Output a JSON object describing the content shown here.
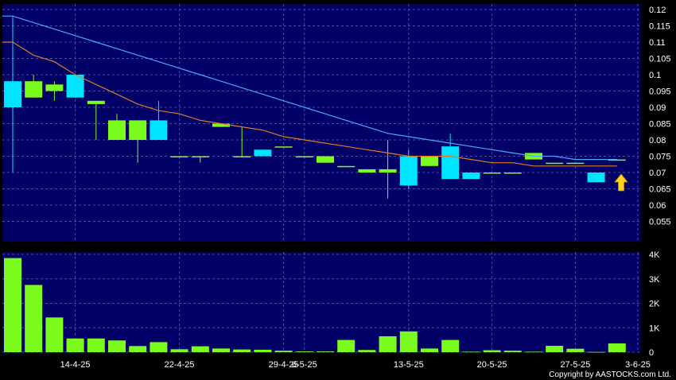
{
  "colors": {
    "panel_bg": "#000066",
    "grid": "#4d4d99",
    "up": "#7cfc1e",
    "down": "#00e5ff",
    "ma_fast": "#e07a2a",
    "ma_slow": "#4aa8ff",
    "volume": "#7cfc1e",
    "arrow": "#ffd21f"
  },
  "chart_data": [
    {
      "type": "candlestick",
      "title": "",
      "ylim": [
        0.05,
        0.12
      ],
      "y_ticks": [
        "0.12",
        "0.115",
        "0.11",
        "0.105",
        "0.1",
        "0.095",
        "0.09",
        "0.085",
        "0.08",
        "0.075",
        "0.07",
        "0.065",
        "0.06",
        "0.055"
      ],
      "x_labels": [
        "14-4-25",
        "22-4-25",
        "29-4-25",
        "6-5-25",
        "13-5-25",
        "20-5-25",
        "27-5-25",
        "3-6-25"
      ],
      "x_label_index": [
        3,
        8,
        13,
        14,
        19,
        23,
        27,
        30
      ],
      "candles": [
        {
          "o": 0.098,
          "h": 0.118,
          "l": 0.07,
          "c": 0.09
        },
        {
          "o": 0.093,
          "h": 0.1,
          "l": 0.093,
          "c": 0.098
        },
        {
          "o": 0.095,
          "h": 0.098,
          "l": 0.092,
          "c": 0.097
        },
        {
          "o": 0.1,
          "h": 0.1,
          "l": 0.093,
          "c": 0.093
        },
        {
          "o": 0.091,
          "h": 0.092,
          "l": 0.08,
          "c": 0.092
        },
        {
          "o": 0.08,
          "h": 0.088,
          "l": 0.08,
          "c": 0.086
        },
        {
          "o": 0.08,
          "h": 0.086,
          "l": 0.073,
          "c": 0.086
        },
        {
          "o": 0.086,
          "h": 0.092,
          "l": 0.08,
          "c": 0.08
        },
        {
          "o": 0.075,
          "h": 0.075,
          "l": 0.075,
          "c": 0.075
        },
        {
          "o": 0.075,
          "h": 0.075,
          "l": 0.073,
          "c": 0.075
        },
        {
          "o": 0.084,
          "h": 0.085,
          "l": 0.084,
          "c": 0.085
        },
        {
          "o": 0.075,
          "h": 0.084,
          "l": 0.075,
          "c": 0.075
        },
        {
          "o": 0.077,
          "h": 0.077,
          "l": 0.075,
          "c": 0.075
        },
        {
          "o": 0.078,
          "h": 0.078,
          "l": 0.078,
          "c": 0.078
        },
        {
          "o": 0.075,
          "h": 0.075,
          "l": 0.075,
          "c": 0.075
        },
        {
          "o": 0.073,
          "h": 0.075,
          "l": 0.073,
          "c": 0.075
        },
        {
          "o": 0.072,
          "h": 0.072,
          "l": 0.072,
          "c": 0.072
        },
        {
          "o": 0.07,
          "h": 0.071,
          "l": 0.07,
          "c": 0.071
        },
        {
          "o": 0.07,
          "h": 0.08,
          "l": 0.062,
          "c": 0.071
        },
        {
          "o": 0.075,
          "h": 0.077,
          "l": 0.065,
          "c": 0.066
        },
        {
          "o": 0.072,
          "h": 0.075,
          "l": 0.072,
          "c": 0.075
        },
        {
          "o": 0.078,
          "h": 0.082,
          "l": 0.068,
          "c": 0.068
        },
        {
          "o": 0.07,
          "h": 0.07,
          "l": 0.068,
          "c": 0.068
        },
        {
          "o": 0.07,
          "h": 0.07,
          "l": 0.07,
          "c": 0.07
        },
        {
          "o": 0.07,
          "h": 0.07,
          "l": 0.07,
          "c": 0.07
        },
        {
          "o": 0.074,
          "h": 0.076,
          "l": 0.074,
          "c": 0.076
        },
        {
          "o": 0.073,
          "h": 0.073,
          "l": 0.073,
          "c": 0.073
        },
        {
          "o": 0.073,
          "h": 0.073,
          "l": 0.073,
          "c": 0.073
        },
        {
          "o": 0.07,
          "h": 0.07,
          "l": 0.067,
          "c": 0.067
        },
        {
          "o": 0.074,
          "h": 0.074,
          "l": 0.074,
          "c": 0.074
        }
      ],
      "ma_fast": [
        0.11,
        0.106,
        0.104,
        0.1,
        0.097,
        0.094,
        0.091,
        0.089,
        0.088,
        0.086,
        0.085,
        0.084,
        0.083,
        0.081,
        0.08,
        0.079,
        0.078,
        0.077,
        0.076,
        0.075,
        0.075,
        0.075,
        0.074,
        0.073,
        0.073,
        0.072,
        0.072,
        0.072,
        0.072,
        0.072
      ],
      "ma_slow": [
        0.118,
        0.116,
        0.114,
        0.112,
        0.11,
        0.108,
        0.106,
        0.104,
        0.102,
        0.1,
        0.098,
        0.096,
        0.094,
        0.092,
        0.09,
        0.088,
        0.086,
        0.084,
        0.082,
        0.081,
        0.08,
        0.079,
        0.078,
        0.077,
        0.076,
        0.075,
        0.075,
        0.074,
        0.074,
        0.074
      ]
    },
    {
      "type": "bar",
      "ylim": [
        0,
        4000
      ],
      "y_ticks": [
        "4K",
        "3K",
        "2K",
        "1K",
        "0"
      ],
      "values": [
        3850,
        2750,
        1420,
        560,
        560,
        480,
        250,
        410,
        120,
        240,
        150,
        110,
        100,
        60,
        30,
        30,
        500,
        90,
        650,
        850,
        150,
        500,
        20,
        80,
        60,
        20,
        260,
        140,
        10,
        360
      ]
    }
  ],
  "annotation_icon": "up-arrow-icon",
  "copyright": "Copyright by AASTOCKS.com Ltd."
}
